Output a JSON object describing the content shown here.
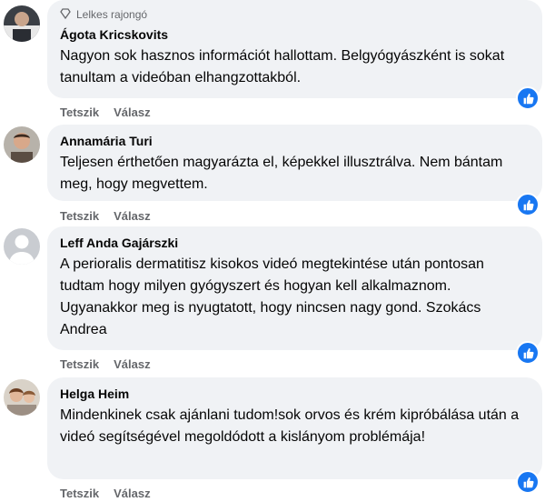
{
  "comments": [
    {
      "badge": "Lelkes rajongó",
      "author": "Ágota Kricskovits",
      "text": "Nagyon sok hasznos információt hallottam. Belgyógyászként is sokat tanultam a videóban elhangzottakból.",
      "like": "Tetszik",
      "reply": "Válasz"
    },
    {
      "author": "Annamária Turi",
      "text": "Teljesen érthetően magyarázta el, képekkel illusztrálva. Nem bántam meg, hogy megvettem.",
      "like": "Tetszik",
      "reply": "Válasz"
    },
    {
      "author": "Leff Anda Gajárszki",
      "text": "A perioralis dermatitisz kisokos videó megtekintése után pontosan tudtam hogy milyen gyógyszert és hogyan kell alkalmaznom. Ugyanakkor meg is nyugtatott, hogy nincsen nagy gond. Szokács Andrea",
      "like": "Tetszik",
      "reply": "Válasz"
    },
    {
      "author": "Helga Heim",
      "text": "Mindenkinek csak ajánlani tudom!sok orvos és krém kipróbálása után a videó segítségével megoldódott a kislányom problémája!",
      "like": "Tetszik",
      "reply": "Válasz"
    }
  ],
  "colors": {
    "bubble": "#f0f2f5",
    "like_badge": "#1877f2",
    "action_text": "#65676b"
  },
  "icons": {
    "badge": "diamond-icon",
    "reaction": "thumbs-up-icon"
  }
}
